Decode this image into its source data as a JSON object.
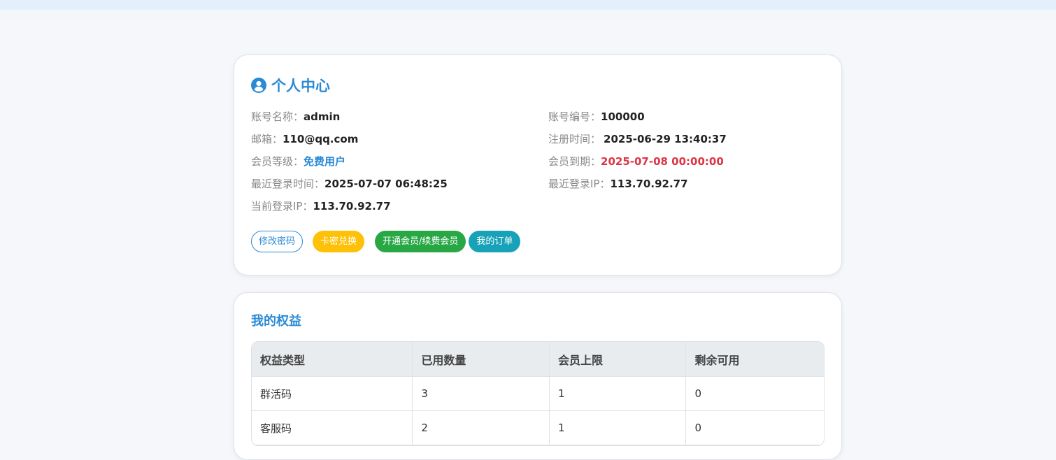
{
  "profile": {
    "title": "个人中心",
    "icon": "user-circle-icon",
    "fields": {
      "account_name": {
        "label": "账号名称：",
        "value": "admin"
      },
      "account_id": {
        "label": "账号编号：",
        "value": "100000"
      },
      "email": {
        "label": "邮箱：",
        "value": "110@qq.com"
      },
      "register_time": {
        "label": "注册时间：",
        "value": "2025-06-29 13:40:37"
      },
      "member_level": {
        "label": "会员等级：",
        "value": "免费用户"
      },
      "member_expire": {
        "label": "会员到期：",
        "value": "2025-07-08 00:00:00"
      },
      "last_login_time": {
        "label": "最近登录时间：",
        "value": "2025-07-07 06:48:25"
      },
      "last_login_ip": {
        "label": "最近登录IP：",
        "value": "113.70.92.77"
      },
      "current_ip": {
        "label": "当前登录IP：",
        "value": "113.70.92.77"
      }
    },
    "buttons": {
      "change_password": "修改密码",
      "redeem_card": "卡密兑换",
      "membership": "开通会员/续费会员",
      "my_orders": "我的订单"
    }
  },
  "rights": {
    "title": "我的权益",
    "columns": [
      "权益类型",
      "已用数量",
      "会员上限",
      "剩余可用"
    ],
    "rows": [
      [
        "群活码",
        "3",
        "1",
        "0"
      ],
      [
        "客服码",
        "2",
        "1",
        "0"
      ]
    ]
  },
  "colors": {
    "accent": "#2a8ad6",
    "expire": "#dc3545",
    "yellow": "#ffc107",
    "green": "#28a745",
    "cyan": "#17a2b8"
  }
}
